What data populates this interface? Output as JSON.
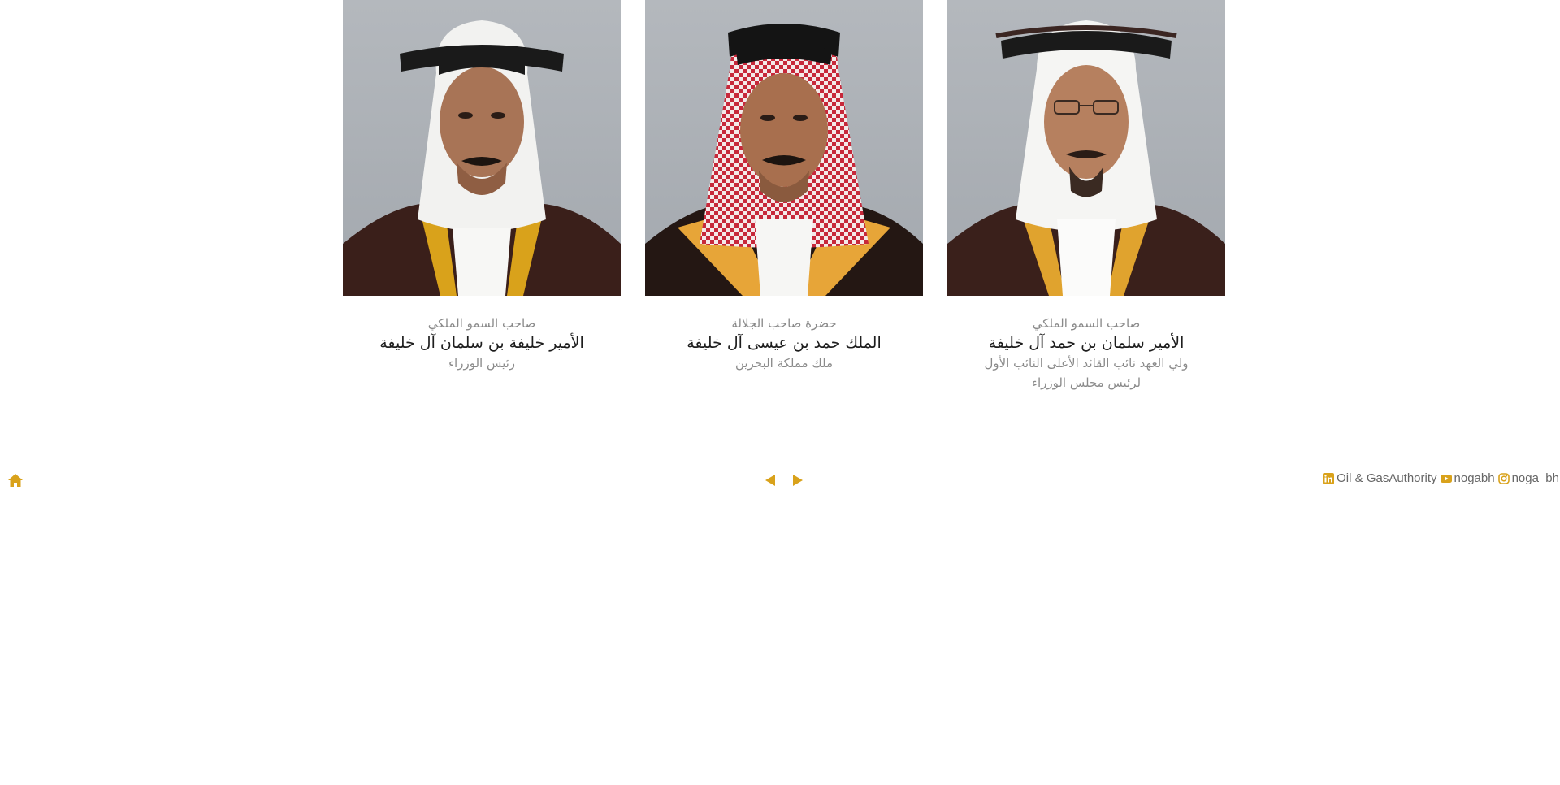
{
  "portraits": [
    {
      "title": "صاحب السمو الملكي",
      "name": "الأمير خليفة بن سلمان آل خليفة",
      "role": "رئيس الوزراء",
      "headwear": "white"
    },
    {
      "title": "حضرة صاحب الجلالة",
      "name": "الملك حمد بن عيسى آل خليفة",
      "role": "ملك مملكة البحرين",
      "headwear": "red-checkered"
    },
    {
      "title": "صاحب السمو الملكي",
      "name": "الأمير سلمان بن حمد آل خليفة",
      "role": "ولي العهد نائب القائد الأعلى النائب الأول لرئيس مجلس الوزراء",
      "headwear": "white"
    }
  ],
  "footer": {
    "home_icon": "home-icon",
    "prev_icon": "triangle-left-icon",
    "next_icon": "triangle-right-icon",
    "social": [
      {
        "icon": "linkedin-icon",
        "label": "Oil & GasAuthority"
      },
      {
        "icon": "youtube-icon",
        "label": "nogabh"
      },
      {
        "icon": "instagram-icon",
        "label": "noga_bh"
      }
    ]
  },
  "colors": {
    "accent": "#d9a21b",
    "photo_bg": "#a8adb3",
    "text_muted": "#8a8a8a",
    "text_dark": "#1e1e1e"
  }
}
